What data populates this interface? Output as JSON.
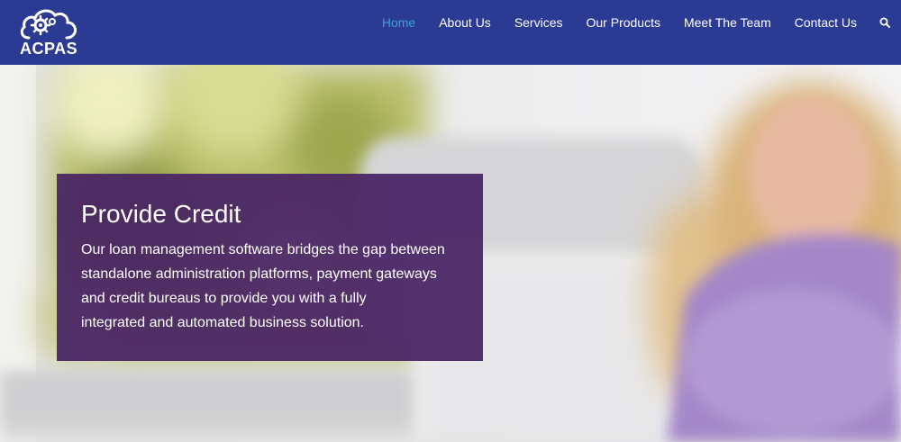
{
  "brand": {
    "name": "ACPAS",
    "logo_icon": "cloud-gears-icon"
  },
  "nav": {
    "items": [
      {
        "label": "Home",
        "active": true
      },
      {
        "label": "About Us",
        "active": false
      },
      {
        "label": "Services",
        "active": false
      },
      {
        "label": "Our Products",
        "active": false
      },
      {
        "label": "Meet The Team",
        "active": false
      },
      {
        "label": "Contact Us",
        "active": false
      }
    ],
    "search_icon": "search-icon"
  },
  "hero": {
    "title": "Provide Credit",
    "body_lines": [
      "Our loan management software bridges the gap between",
      "standalone administration platforms, payment gateways",
      "and credit bureaus to provide you with a fully",
      "integrated and automated business solution."
    ]
  },
  "colors": {
    "header_bg": "#2b3a93",
    "nav_active": "#3fa0d6",
    "card_bg": "#482464"
  }
}
